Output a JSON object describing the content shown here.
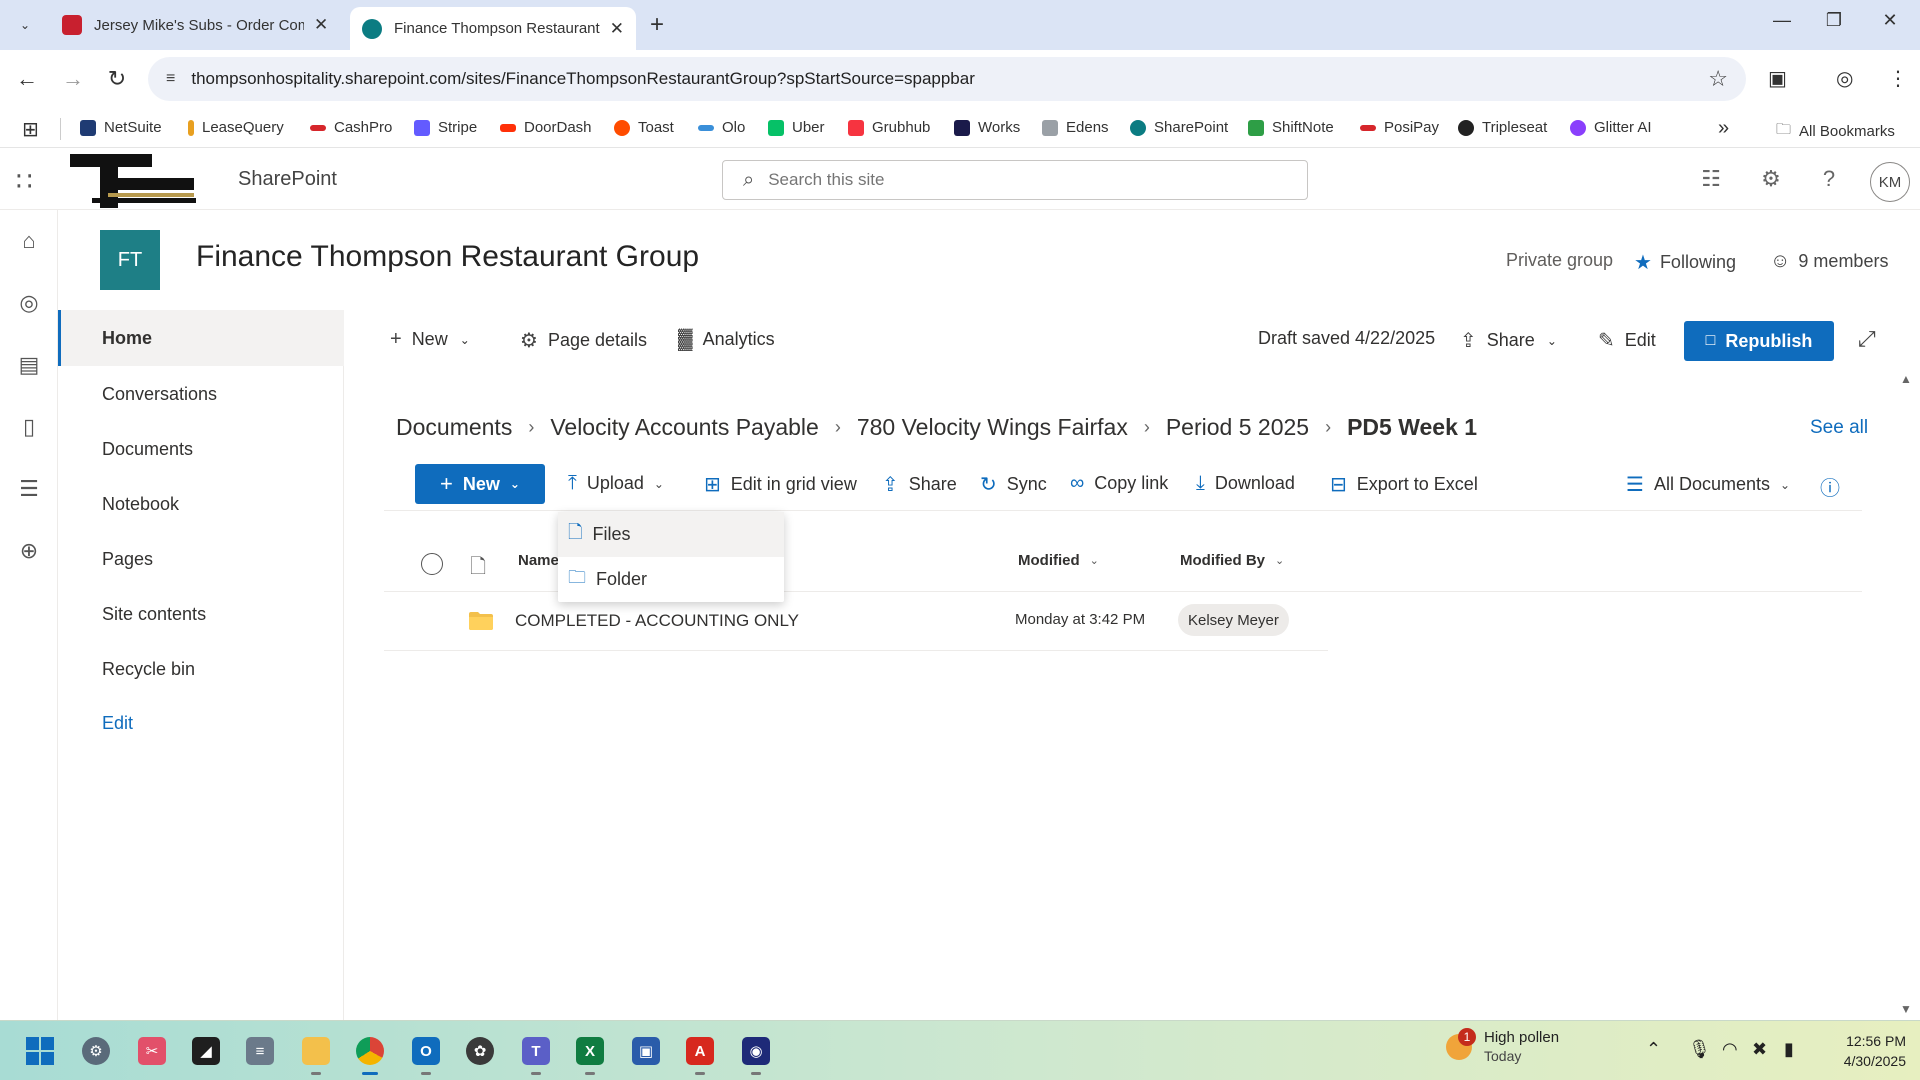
{
  "browser": {
    "tabs": [
      {
        "title": "Jersey Mike's Subs - Order Com",
        "active": false
      },
      {
        "title": "Finance Thompson Restaurant G",
        "active": true
      }
    ],
    "url": "thompsonhospitality.sharepoint.com/sites/FinanceThompsonRestaurantGroup?spStartSource=spappbar",
    "bookmarks": [
      "NetSuite",
      "LeaseQuery",
      "CashPro",
      "Stripe",
      "DoorDash",
      "Toast",
      "Olo",
      "Uber",
      "Grubhub",
      "Works",
      "Edens",
      "SharePoint",
      "ShiftNote",
      "PosiPay",
      "Tripleseat",
      "Glitter AI"
    ],
    "all_bookmarks": "All Bookmarks"
  },
  "suite": {
    "app_name": "SharePoint",
    "search_placeholder": "Search this site",
    "avatar_initials": "KM"
  },
  "site": {
    "logo_initials": "FT",
    "title": "Finance Thompson Restaurant Group",
    "privacy": "Private group",
    "following": "Following",
    "members": "9 members"
  },
  "leftnav": {
    "items": [
      "Home",
      "Conversations",
      "Documents",
      "Notebook",
      "Pages",
      "Site contents",
      "Recycle bin"
    ],
    "edit": "Edit"
  },
  "page_cmd": {
    "new": "New",
    "page_details": "Page details",
    "analytics": "Analytics",
    "draft_status": "Draft saved 4/22/2025",
    "share": "Share",
    "edit": "Edit",
    "republish": "Republish"
  },
  "breadcrumb": [
    "Documents",
    "Velocity Accounts Payable",
    "780 Velocity Wings Fairfax",
    "Period 5 2025",
    "PD5 Week 1"
  ],
  "see_all": "See all",
  "lib_cmd": {
    "new": "New",
    "upload": "Upload",
    "grid_view": "Edit in grid view",
    "share": "Share",
    "sync": "Sync",
    "copy_link": "Copy link",
    "download": "Download",
    "export": "Export to Excel",
    "view": "All Documents"
  },
  "upload_menu": [
    "Files",
    "Folder"
  ],
  "list": {
    "columns": {
      "name": "Name",
      "modified": "Modified",
      "modified_by": "Modified By"
    },
    "rows": [
      {
        "name": "COMPLETED - ACCOUNTING ONLY",
        "modified": "Monday at 3:42 PM",
        "modified_by": "Kelsey Meyer",
        "type": "folder"
      }
    ]
  },
  "taskbar": {
    "weather_badge": "1",
    "weather_title": "High pollen",
    "weather_sub": "Today",
    "time": "12:56 PM",
    "date": "4/30/2025"
  },
  "colors": {
    "accent": "#0f6cbd",
    "site_logo": "#1e7f86",
    "folder": "#f3c04b"
  }
}
